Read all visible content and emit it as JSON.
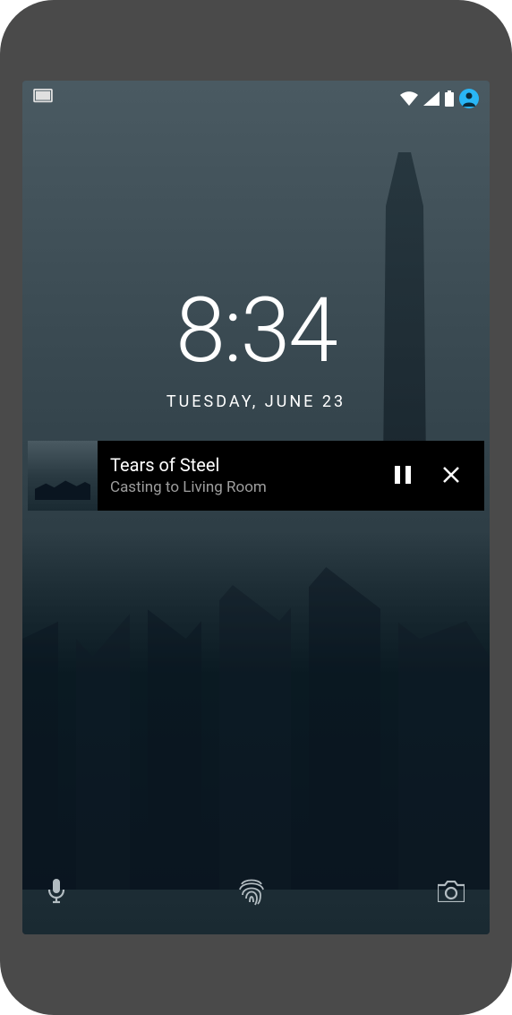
{
  "status": {
    "icons": {
      "cast": "cast-connected-icon",
      "wifi": "wifi-icon",
      "cell": "cellular-icon",
      "battery": "battery-icon",
      "profile": "profile-icon"
    },
    "accent_color": "#29b6f6"
  },
  "lockscreen": {
    "time": "8:34",
    "date": "TUESDAY, JUNE 23"
  },
  "media": {
    "title": "Tears of Steel",
    "subtitle": "Casting to Living Room",
    "play_state": "playing"
  },
  "bottom": {
    "left": "mic-icon",
    "center": "fingerprint-icon",
    "right": "camera-icon"
  }
}
